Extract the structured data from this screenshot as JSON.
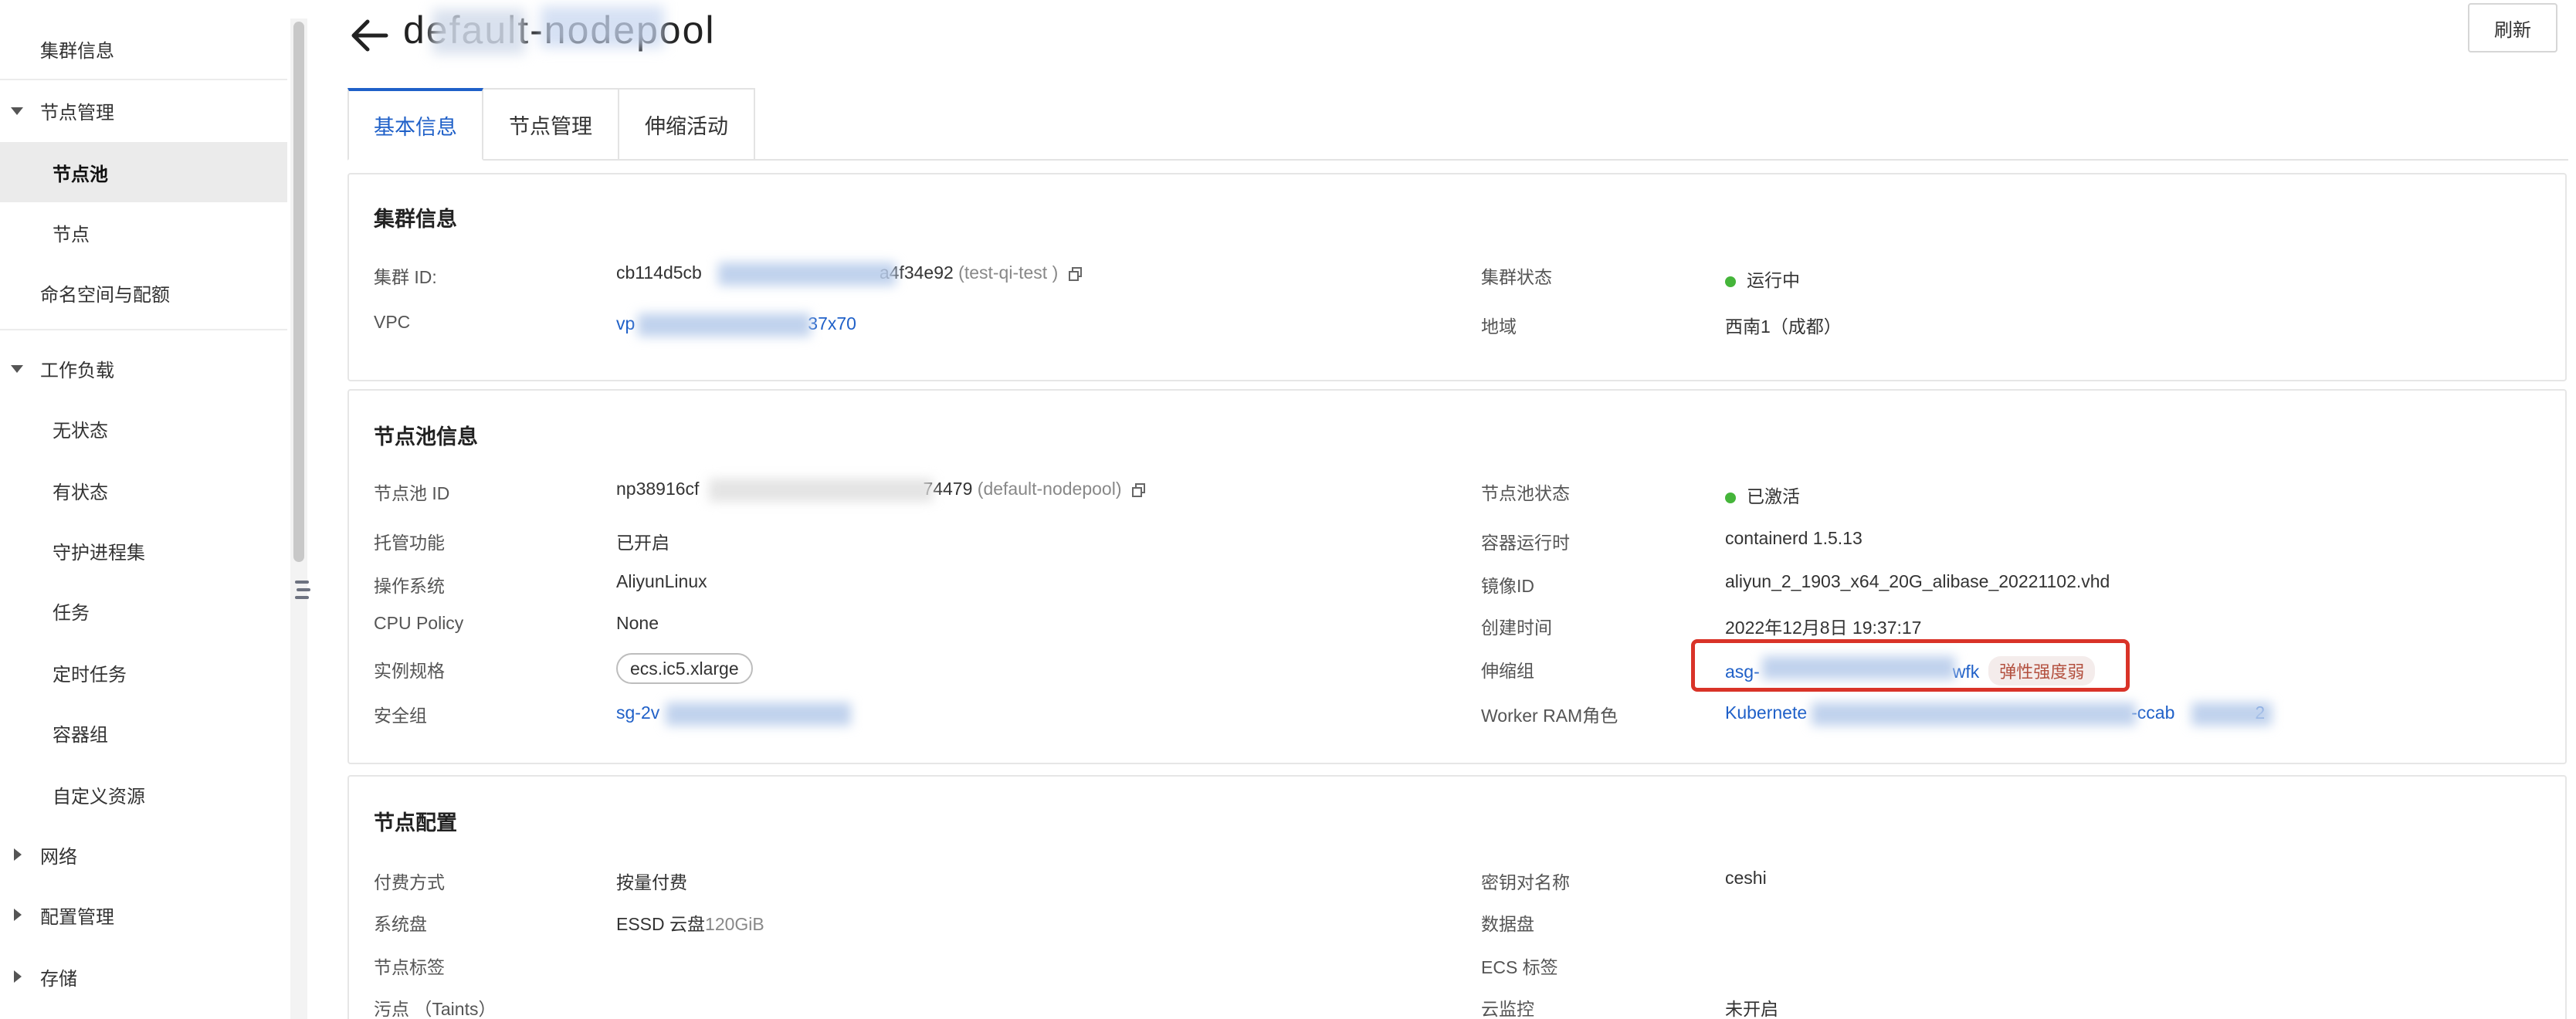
{
  "sidebar": {
    "items": [
      {
        "label": "集群信息"
      },
      {
        "label": "节点管理"
      },
      {
        "label": "节点池"
      },
      {
        "label": "节点"
      },
      {
        "label": "命名空间与配额"
      },
      {
        "label": "工作负载"
      },
      {
        "label": "无状态"
      },
      {
        "label": "有状态"
      },
      {
        "label": "守护进程集"
      },
      {
        "label": "任务"
      },
      {
        "label": "定时任务"
      },
      {
        "label": "容器组"
      },
      {
        "label": "自定义资源"
      },
      {
        "label": "网络"
      },
      {
        "label": "配置管理"
      },
      {
        "label": "存储"
      }
    ]
  },
  "header": {
    "title": "default-nodepool",
    "refresh_label": "刷新"
  },
  "tabs": [
    {
      "label": "基本信息"
    },
    {
      "label": "节点管理"
    },
    {
      "label": "伸缩活动"
    }
  ],
  "cluster": {
    "title": "集群信息",
    "id_label": "集群 ID:",
    "id_value": "cb114d5cb",
    "id_value_tail": "a4f34e92",
    "id_name": "(test-qi-test )",
    "vpc_label": "VPC",
    "vpc_value_head": "vp",
    "vpc_value_tail": "37x70",
    "status_label": "集群状态",
    "status_value": "运行中",
    "region_label": "地域",
    "region_value": "西南1（成都）"
  },
  "nodepool": {
    "title": "节点池信息",
    "id_label": "节点池 ID",
    "id_value_head": "np38916cf",
    "id_value_tail": "74479",
    "id_name": "(default-nodepool)",
    "managed_label": "托管功能",
    "managed_value": "已开启",
    "os_label": "操作系统",
    "os_value": "AliyunLinux",
    "cpu_label": "CPU Policy",
    "cpu_value": "None",
    "spec_label": "实例规格",
    "spec_value": "ecs.ic5.xlarge",
    "sg_label": "安全组",
    "sg_value_head": "sg-2v",
    "status_label": "节点池状态",
    "status_value": "已激活",
    "runtime_label": "容器运行时",
    "runtime_value": "containerd 1.5.13",
    "image_label": "镜像ID",
    "image_value": "aliyun_2_1903_x64_20G_alibase_20221102.vhd",
    "created_label": "创建时间",
    "created_value": "2022年12月8日 19:37:17",
    "asg_label": "伸缩组",
    "asg_value_head": "asg-",
    "asg_value_tail": "wfk",
    "asg_badge": "弹性强度弱",
    "ram_label": "Worker RAM角色",
    "ram_value_head": "Kubernete",
    "ram_value_mid": "-ccab",
    "ram_value_tail": "2"
  },
  "nodeconfig": {
    "title": "节点配置",
    "billing_label": "付费方式",
    "billing_value": "按量付费",
    "sysdisk_label": "系统盘",
    "sysdisk_value": "ESSD 云盘",
    "sysdisk_size": "120GiB",
    "nodelabel_label": "节点标签",
    "taint_label": "污点 （Taints）",
    "keypair_label": "密钥对名称",
    "keypair_value": "ceshi",
    "datadisk_label": "数据盘",
    "ecstag_label": "ECS 标签",
    "monitor_label": "云监控",
    "monitor_value": "未开启"
  }
}
